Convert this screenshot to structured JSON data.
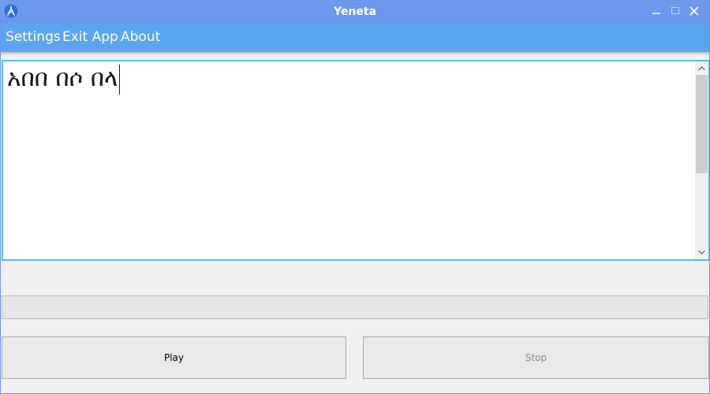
{
  "window": {
    "title": "Yeneta",
    "accent_color": "#6e97ee",
    "app_icon": "amharic-letter-icon"
  },
  "menu": {
    "bar_color": "#5aa5ef",
    "items": [
      {
        "label": "Settings"
      },
      {
        "label": "Exit App"
      },
      {
        "label": "About"
      }
    ]
  },
  "editor": {
    "text": "አበበ በሶ በላ",
    "border_color": "#55c0e6"
  },
  "progress": {
    "value_percent": 0
  },
  "buttons": {
    "play_label": "Play",
    "stop_label": "Stop",
    "stop_enabled": false
  }
}
